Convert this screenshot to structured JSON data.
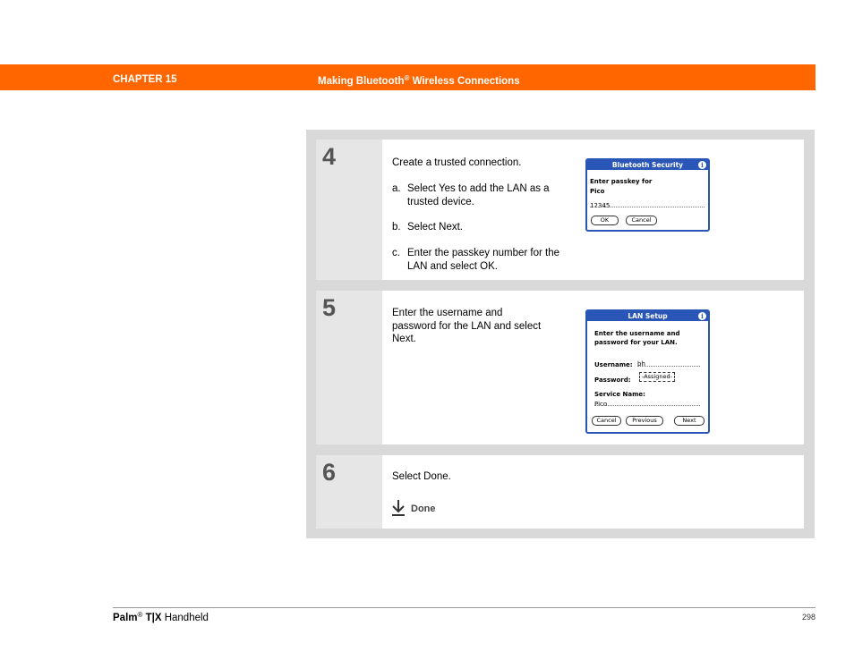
{
  "header": {
    "chapter": "CHAPTER 15",
    "title_main": "Making Bluetooth",
    "title_sup": "®",
    "title_rest": " Wireless Connections",
    "bar_color": "#ff6600"
  },
  "steps": [
    {
      "number": "4",
      "intro": "Create a trusted connection.",
      "items": [
        {
          "letter": "a.",
          "text": "Select Yes to add the LAN as a trusted device."
        },
        {
          "letter": "b.",
          "text": "Select Next."
        },
        {
          "letter": "c.",
          "text": "Enter the passkey number for the LAN and select OK."
        }
      ],
      "dialog": {
        "title": "Bluetooth Security",
        "info_icon": "i",
        "prompt_line1": "Enter passkey for",
        "prompt_line2": "Pico",
        "passkey": "12345",
        "ok_label": "OK",
        "cancel_label": "Cancel"
      }
    },
    {
      "number": "5",
      "text": "Enter the username and password for the LAN and select Next.",
      "dialog": {
        "title": "LAN Setup",
        "info_icon": "i",
        "prompt_line1": "Enter the username and",
        "prompt_line2": "password for your LAN.",
        "username_label": "Username:",
        "username_value": "bh",
        "password_label": "Password:",
        "password_value": "-Assigned-",
        "service_label": "Service Name:",
        "service_value": "Pico",
        "cancel_label": "Cancel",
        "previous_label": "Previous",
        "next_label": "Next"
      }
    },
    {
      "number": "6",
      "text": "Select Done.",
      "done_label": "Done"
    }
  ],
  "footer": {
    "brand": "Palm",
    "brand_sup": "®",
    "model": " T|X",
    "product": " Handheld",
    "page": "298"
  }
}
